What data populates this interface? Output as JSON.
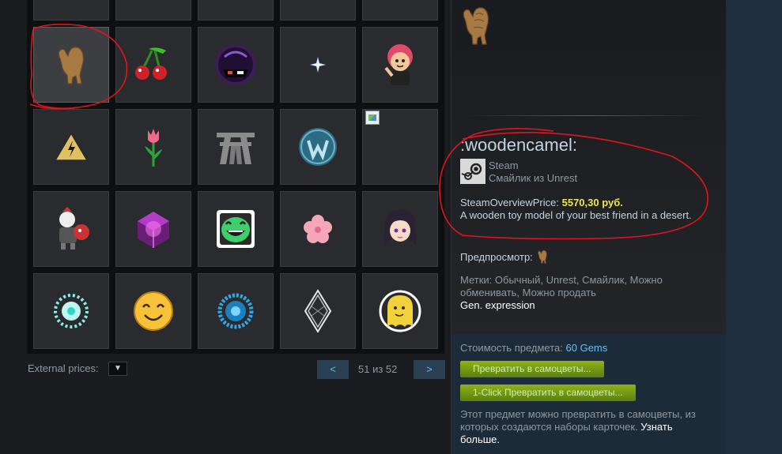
{
  "grid": {
    "items": [
      {
        "name": "top-partial-1"
      },
      {
        "name": "top-partial-2"
      },
      {
        "name": "top-partial-3"
      },
      {
        "name": "top-partial-4"
      },
      {
        "name": "top-partial-5"
      },
      {
        "name": "wooden-camel",
        "selected": true
      },
      {
        "name": "cherries"
      },
      {
        "name": "purple-helmet"
      },
      {
        "name": "ice-crystal"
      },
      {
        "name": "red-hair-character"
      },
      {
        "name": "warning-sign"
      },
      {
        "name": "pink-tulip"
      },
      {
        "name": "gate-logo"
      },
      {
        "name": "watchdogs-logo"
      },
      {
        "name": "broken-image"
      },
      {
        "name": "armored-character"
      },
      {
        "name": "magenta-cube"
      },
      {
        "name": "green-smiley"
      },
      {
        "name": "pink-flower"
      },
      {
        "name": "anime-girl"
      },
      {
        "name": "teal-snowflake"
      },
      {
        "name": "happy-face"
      },
      {
        "name": "blue-snowflake"
      },
      {
        "name": "crystal-diamond"
      },
      {
        "name": "yellow-ghost"
      }
    ]
  },
  "controls": {
    "external_prices_label": "External prices:",
    "external_prices_arrow": "▼",
    "prev_label": "<",
    "next_label": ">",
    "page_indicator": "51 из 52"
  },
  "detail": {
    "item_name": ":woodencamel:",
    "source_game": "Steam",
    "item_type": "Смайлик из Unrest",
    "price_label": "SteamOverviewPrice:",
    "price_value": "5570,30 руб.",
    "description": "A wooden toy model of your best friend in a desert.",
    "preview_label": "Предпросмотр:",
    "tags_text": "Метки: Обычный, Unrest, Смайлик, Можно обменивать, Можно продать",
    "gen_expression": "Gen. expression"
  },
  "gems": {
    "cost_label": "Стоимость предмета:",
    "cost_value": "60 Gems",
    "convert_button": "Превратить в самоцветы...",
    "one_click_button": "1-Click Превратить в самоцветы...",
    "note_text": "Этот предмет можно превратить в самоцветы, из которых создаются наборы карточек.",
    "learn_more": "Узнать больше."
  },
  "colors": {
    "price_yellow": "#e9e94b",
    "link_blue": "#66c0f4",
    "button_green": "#8fb21a",
    "annotation_red": "#e0141e"
  }
}
